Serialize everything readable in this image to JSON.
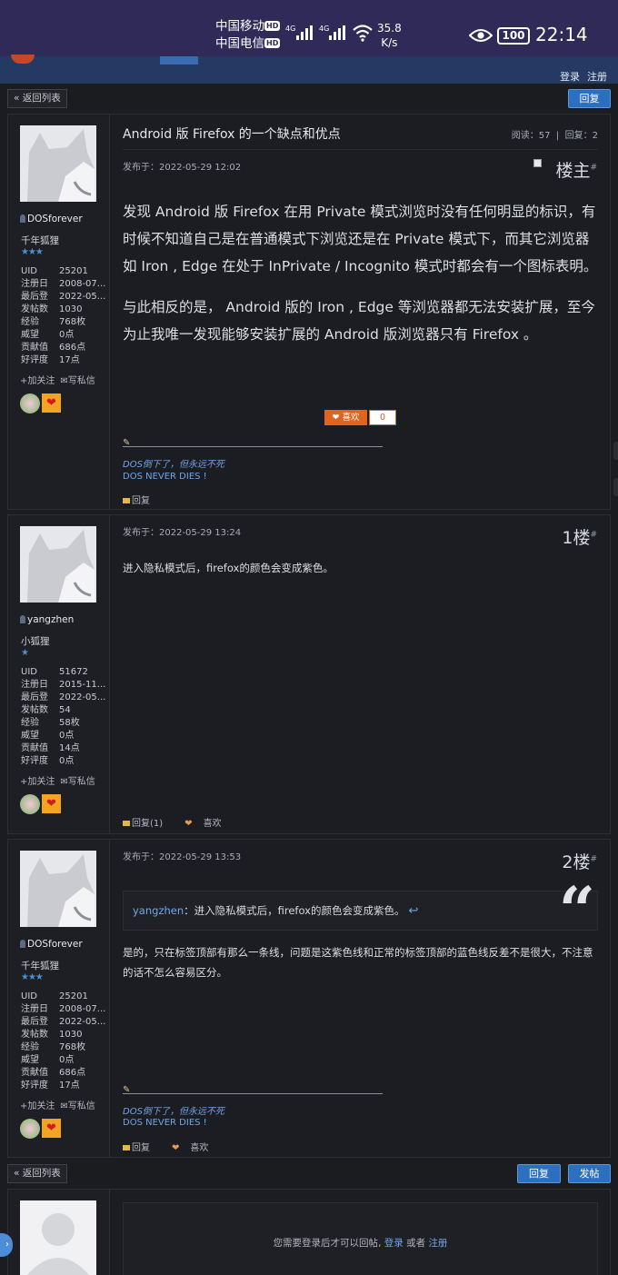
{
  "status_bar": {
    "carrier1": "中国移动",
    "carrier2": "中国电信",
    "hd_badge": "HD",
    "network_gen": "4G",
    "speed_value": "35.8",
    "speed_unit": "K/s",
    "battery": "100",
    "time": "22:14"
  },
  "header": {
    "login": "登录",
    "register": "注册"
  },
  "toolbar": {
    "back_label": "« 返回列表",
    "reply_label": "回复",
    "post_label": "发帖"
  },
  "thread": {
    "title": "Android 版 Firefox 的一个缺点和优点",
    "views": "阅读：57",
    "replies": "回复：2"
  },
  "labels": {
    "uid": "UID",
    "registered": "注册日",
    "last_login": "最后登",
    "posts": "发帖数",
    "exp": "经验",
    "prestige": "威望",
    "contribution": "贡献值",
    "favor": "好评度",
    "follow": "+加关注",
    "message": "写私信"
  },
  "posts": [
    {
      "author": "DOSforever",
      "rank": "千年狐狸",
      "stars": "★★★",
      "uid": "25201",
      "registered": "2008-07...",
      "last_login": "2022-05...",
      "posts": "1030",
      "exp": "768枚",
      "prestige": "0点",
      "contribution": "686点",
      "favor": "17点",
      "published": "发布于：2022-05-29 12:02",
      "floor": "楼主",
      "floor_mark": "#",
      "body_p1": "发现 Android 版 Firefox 在用 Private 模式浏览时没有任何明显的标识，有时候不知道自己是在普通模式下浏览还是在 Private 模式下，而其它浏览器如 Iron , Edge 在处于 InPrivate / Incognito 模式时都会有一个图标表明。",
      "body_p2": "与此相反的是， Android 版的 Iron , Edge 等浏览器都无法安装扩展，至今为止我唯一发现能够安装扩展的 Android 版浏览器只有 Firefox 。",
      "like_label": "喜欢",
      "like_count": "0",
      "sig1": "DOS倒下了，但永远不死",
      "sig2": "DOS NEVER DIES !",
      "reply": "回复"
    },
    {
      "author": "yangzhen",
      "rank": "小狐狸",
      "stars": "★",
      "uid": "51672",
      "registered": "2015-11...",
      "last_login": "2022-05...",
      "posts": "54",
      "exp": "58枚",
      "prestige": "0点",
      "contribution": "14点",
      "favor": "0点",
      "published": "发布于：2022-05-29 13:24",
      "floor": "1楼",
      "floor_mark": "#",
      "body": "进入隐私模式后，firefox的颜色会变成紫色。",
      "reply": "回复(1)",
      "like": "喜欢"
    },
    {
      "author": "DOSforever",
      "rank": "千年狐狸",
      "stars": "★★★",
      "uid": "25201",
      "registered": "2008-07...",
      "last_login": "2022-05...",
      "posts": "1030",
      "exp": "768枚",
      "prestige": "0点",
      "contribution": "686点",
      "favor": "17点",
      "published": "发布于：2022-05-29 13:53",
      "floor": "2楼",
      "floor_mark": "#",
      "quote_user": "yangzhen",
      "quote_text": "：进入隐私模式后，firefox的颜色会变成紫色。",
      "body": "是的，只在标签顶部有那么一条线，问题是这紫色线和正常的标签顶部的蓝色线反差不是很大，不注意的话不怎么容易区分。",
      "sig1": "DOS倒下了，但永远不死",
      "sig2": "DOS NEVER DIES !",
      "reply": "回复",
      "like": "喜欢"
    }
  ],
  "reply_prompt": {
    "text": "您需要登录后才可以回帖",
    "login": "登录",
    "or": " 或者 ",
    "register": "注册"
  },
  "colors": {
    "accent": "#2c6fbf",
    "link": "#6fa6e6",
    "status_bar": "#2f2a57",
    "like": "#e0641e"
  }
}
